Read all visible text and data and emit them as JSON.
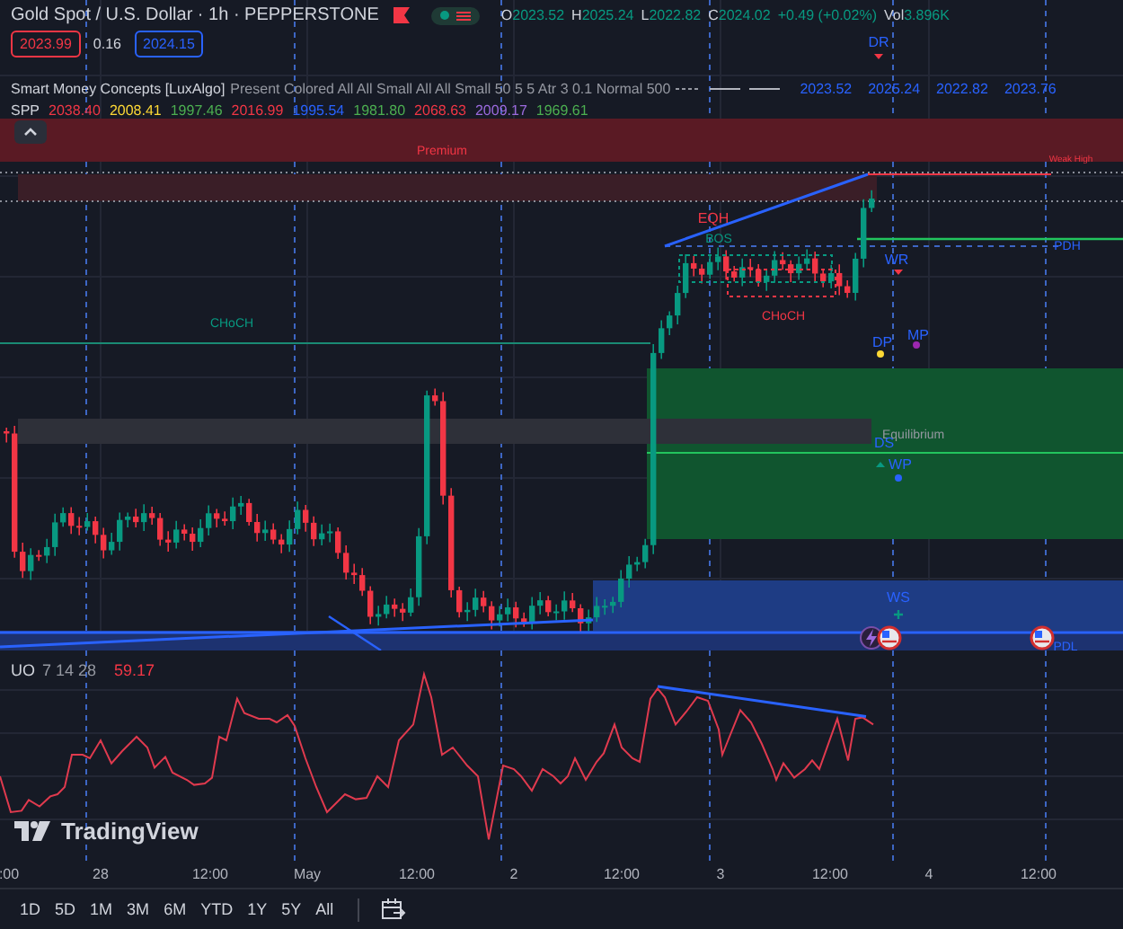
{
  "header": {
    "symbol": "Gold Spot / U.S. Dollar · 1h · PEPPERSTONE",
    "ohlc": [
      {
        "label": "O",
        "value": "2023.52"
      },
      {
        "label": "H",
        "value": "2025.24"
      },
      {
        "label": "L",
        "value": "2022.82"
      },
      {
        "label": "C",
        "value": "2024.02"
      }
    ],
    "change": "+0.49 (+0.02%)",
    "volume": {
      "label": "Vol",
      "value": "3.896K"
    }
  },
  "market_status": {
    "open": true
  },
  "quote": {
    "sell": "2023.99",
    "spread": "0.16",
    "buy": "2024.15"
  },
  "indicators": [
    {
      "name": "Smart Money Concepts [LuxAlgo]",
      "params": "Present Colored All All Small All All Small 50 5 5 Atr 3 0.1 Normal 500",
      "values": [
        {
          "text": "2023.52",
          "color": "#2962ff"
        },
        {
          "text": "2025.24",
          "color": "#2962ff"
        },
        {
          "text": "2022.82",
          "color": "#2962ff"
        },
        {
          "text": "2023.76",
          "color": "#2962ff"
        }
      ]
    },
    {
      "name": "SPP",
      "values": [
        {
          "text": "2038.40",
          "color": "#f23645"
        },
        {
          "text": "2008.41",
          "color": "#fdd835"
        },
        {
          "text": "1997.46",
          "color": "#4caf50"
        },
        {
          "text": "2016.99",
          "color": "#f23645"
        },
        {
          "text": "1995.54",
          "color": "#2962ff"
        },
        {
          "text": "1981.80",
          "color": "#4caf50"
        },
        {
          "text": "2068.63",
          "color": "#f23645"
        },
        {
          "text": "2009.17",
          "color": "#9c6ade"
        },
        {
          "text": "1969.61",
          "color": "#4caf50"
        }
      ]
    }
  ],
  "chart_labels": [
    {
      "text": "DR",
      "color": "#2962ff"
    },
    {
      "text": "Premium",
      "color": "#f23645"
    },
    {
      "text": "Weak High",
      "color": "#f23645"
    },
    {
      "text": "EQH",
      "color": "#f23645"
    },
    {
      "text": "BOS",
      "color": "#089981"
    },
    {
      "text": "CHoCH",
      "color": "#089981"
    },
    {
      "text": "CHoCH",
      "color": "#f23645"
    },
    {
      "text": "PDH",
      "color": "#2962ff"
    },
    {
      "text": "WR",
      "color": "#2962ff"
    },
    {
      "text": "DP",
      "color": "#2962ff"
    },
    {
      "text": "MP",
      "color": "#2962ff"
    },
    {
      "text": "Equilibrium",
      "color": "#9598a1"
    },
    {
      "text": "DS",
      "color": "#2962ff"
    },
    {
      "text": "WP",
      "color": "#2962ff"
    },
    {
      "text": "WS",
      "color": "#2962ff"
    },
    {
      "text": "PDL",
      "color": "#2962ff"
    }
  ],
  "oscillator": {
    "name": "UO",
    "params": "7 14 28",
    "value": "59.17"
  },
  "logo": "TradingView",
  "time_axis": [
    ":00",
    "28",
    "12:00",
    "May",
    "12:00",
    "2",
    "12:00",
    "3",
    "12:00",
    "4",
    "12:00"
  ],
  "range_buttons": [
    "1D",
    "5D",
    "1M",
    "3M",
    "6M",
    "YTD",
    "1Y",
    "5Y",
    "All"
  ]
}
